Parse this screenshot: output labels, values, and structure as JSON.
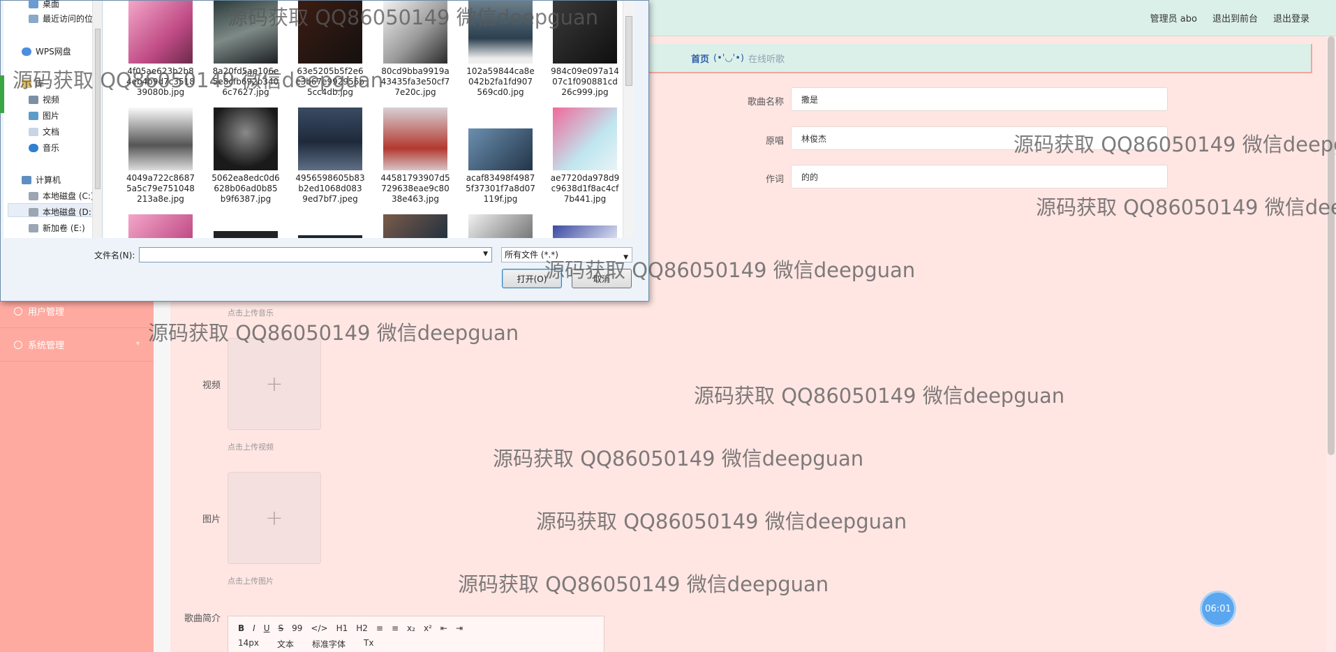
{
  "header": {
    "admin_label": "管理员 abo",
    "front_label": "退出到前台",
    "logout_label": "退出登录"
  },
  "breadcrumb": {
    "home": "首页",
    "sep": "(•'◡'•)",
    "current": "在线听歌"
  },
  "sidebar": {
    "items": [
      {
        "label": "用户管理"
      },
      {
        "label": "系统管理"
      }
    ]
  },
  "form": {
    "song_name_label": "歌曲名称",
    "song_name_value": "撒是",
    "singer_label": "原唱",
    "singer_value": "林俊杰",
    "lyricist_label": "作词",
    "lyricist_value": "的的",
    "music_tip": "点击上传音乐",
    "video_label": "视频",
    "video_tip": "点击上传视频",
    "image_label": "图片",
    "image_tip": "点击上传图片",
    "intro_label": "歌曲简介",
    "upload_plus": "+"
  },
  "editor": {
    "toolbar_row1": [
      "B",
      "I",
      "U",
      "S",
      "99",
      "</>",
      "H1",
      "H2",
      "≡",
      "≡",
      "x₂",
      "x²",
      "⇤",
      "⇥"
    ],
    "font_size": "14px",
    "text_type": "文本",
    "font_family": "标准字体",
    "clear": "Tx"
  },
  "timer": {
    "value": "06:01"
  },
  "dialog": {
    "nav": [
      {
        "label": "桌面",
        "icon": "desktop-icon"
      },
      {
        "label": "最近访问的位置",
        "icon": "recent-icon"
      },
      {
        "label": "WPS网盘",
        "icon": "cloud-icon"
      },
      {
        "label": "库",
        "icon": "library-icon"
      },
      {
        "label": "视频",
        "icon": "video-icon"
      },
      {
        "label": "图片",
        "icon": "picture-icon"
      },
      {
        "label": "文档",
        "icon": "document-icon"
      },
      {
        "label": "音乐",
        "icon": "music-icon"
      },
      {
        "label": "计算机",
        "icon": "computer-icon"
      },
      {
        "label": "本地磁盘 (C:)",
        "icon": "drive-icon"
      },
      {
        "label": "本地磁盘 (D:)",
        "icon": "drive-icon"
      },
      {
        "label": "新加卷 (E:)",
        "icon": "drive-icon"
      }
    ],
    "files": [
      {
        "name": [
          "4f05ae623b2b8",
          "4eb4b9d7c3518",
          "39080b.jpg"
        ]
      },
      {
        "name": [
          "8a20fd5ae106e",
          "5e8cfb692b340",
          "6c7627.jpg"
        ]
      },
      {
        "name": [
          "63e5205b5f2e6",
          "c3b67e992956b",
          "5cc4db.jpg"
        ]
      },
      {
        "name": [
          "80cd9bba9919a",
          "43435fa3e50cf7",
          "7e20c.jpg"
        ]
      },
      {
        "name": [
          "102a59844ca8e",
          "042b2fa1fd907",
          "569cd0.jpg"
        ]
      },
      {
        "name": [
          "984c09e097a14",
          "07c1f090881cd",
          "26c999.jpg"
        ]
      },
      {
        "name": [
          "4049a722c8687",
          "5a5c79e751048",
          "213a8e.jpg"
        ]
      },
      {
        "name": [
          "5062ea8edc0d6",
          "628b06ad0b85",
          "b9f6387.jpg"
        ]
      },
      {
        "name": [
          "4956598605b83",
          "b2ed1068d083",
          "9ed7bf7.jpeg"
        ]
      },
      {
        "name": [
          "44581793907d5",
          "729638eae9c80",
          "38e463.jpg"
        ]
      },
      {
        "name": [
          "acaf83498f4987",
          "5f37301f7a8d07",
          "119f.jpg"
        ]
      },
      {
        "name": [
          "ae7720da978d9",
          "c9638d1f8ac4cf",
          "7b441.jpg"
        ]
      }
    ],
    "filename_label": "文件名(N):",
    "filename_value": "",
    "filetype_value": "所有文件 (*.*)",
    "open_label": "打开(O)",
    "cancel_label": "取消"
  },
  "watermark": "源码获取 QQ86050149 微信deepguan",
  "colors": {
    "sidebar": "#ffaaa0",
    "topbar": "#dbf0e8",
    "content": "#ffe6e3",
    "accent": "#5aa6ef"
  }
}
